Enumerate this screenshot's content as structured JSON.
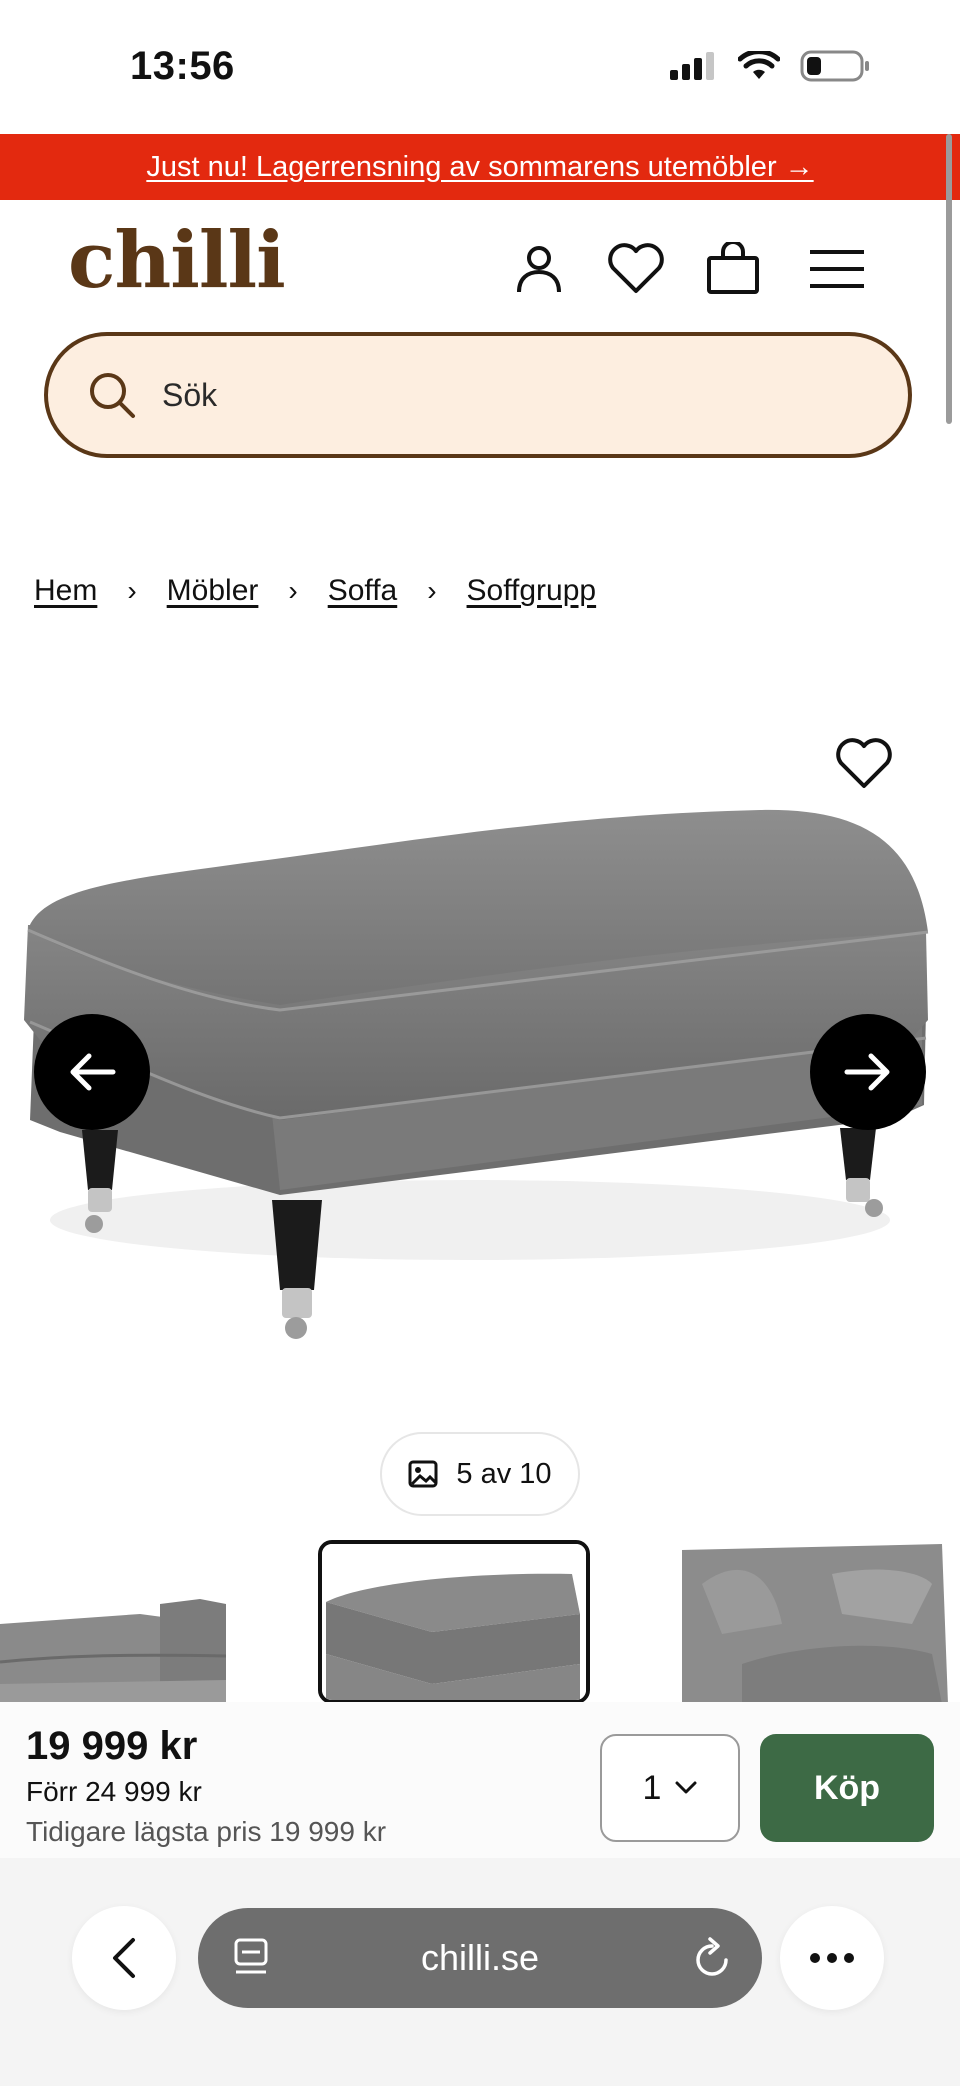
{
  "status_bar": {
    "time": "13:56"
  },
  "promo": {
    "text": "Just nu! Lagerrensning av sommarens utemöbler →"
  },
  "header": {
    "logo": "chilli"
  },
  "search": {
    "placeholder": "Sök"
  },
  "breadcrumb": {
    "items": [
      "Hem",
      "Möbler",
      "Soffa",
      "Soffgrupp"
    ],
    "separator": "›"
  },
  "gallery": {
    "counter": "5 av 10"
  },
  "buy": {
    "price": "19 999 kr",
    "before": "Förr 24 999 kr",
    "lowest": "Tidigare lägsta pris 19 999 kr",
    "quantity": "1",
    "button": "Köp",
    "button_color": "#3d6a45"
  },
  "browser": {
    "url": "chilli.se"
  },
  "colors": {
    "promo": "#e3290f",
    "brand": "#5a3717",
    "search_bg": "#fdeee0"
  },
  "icons": [
    "signal-icon",
    "wifi-icon",
    "battery-icon",
    "account-icon",
    "heart-icon",
    "bag-icon",
    "menu-icon",
    "search-icon",
    "arrow-left-icon",
    "arrow-right-icon",
    "image-icon",
    "chevron-down-icon",
    "back-icon",
    "tabs-icon",
    "reload-icon",
    "more-icon"
  ]
}
